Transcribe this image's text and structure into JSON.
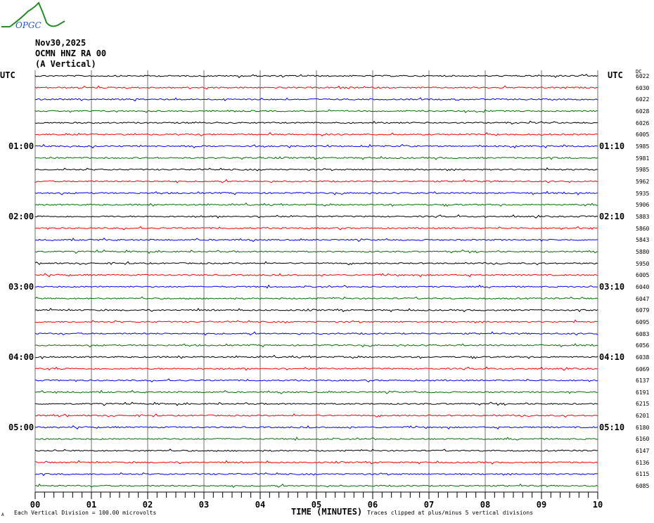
{
  "header": {
    "logo_text": "OPGC",
    "date": "Nov30,2025",
    "station": "OCMN HNZ RA 00",
    "component": "(A Vertical)",
    "utc_left": "UTC",
    "utc_right": "UTC",
    "dc_label": "DC"
  },
  "footer": {
    "division": "Each Vertical Division =  100.00 microvolts",
    "xlabel": "TIME (MINUTES)",
    "clipped": "Traces clipped at plus/minus 5 vertical divisions",
    "corner_mark": "A"
  },
  "chart_data": {
    "type": "line",
    "title": "Nov30,2025 OCMN HNZ RA 00 (A Vertical)",
    "xlabel": "TIME (MINUTES)",
    "xlim": [
      0,
      10
    ],
    "x_ticks": [
      "00",
      "01",
      "02",
      "03",
      "04",
      "05",
      "06",
      "07",
      "08",
      "09",
      "10"
    ],
    "left_hour_labels": [
      {
        "trace": 6,
        "text": "01:00"
      },
      {
        "trace": 12,
        "text": "02:00"
      },
      {
        "trace": 18,
        "text": "03:00"
      },
      {
        "trace": 24,
        "text": "04:00"
      },
      {
        "trace": 30,
        "text": "05:00"
      }
    ],
    "right_hour_labels": [
      {
        "trace": 6,
        "text": "01:10"
      },
      {
        "trace": 12,
        "text": "02:10"
      },
      {
        "trace": 18,
        "text": "03:10"
      },
      {
        "trace": 24,
        "text": "04:10"
      },
      {
        "trace": 30,
        "text": "05:10"
      }
    ],
    "trace_colors": [
      "#000000",
      "#ff0000",
      "#0000ff",
      "#007000"
    ],
    "dc_offsets": [
      6022,
      6030,
      6022,
      6028,
      6026,
      6005,
      5985,
      5981,
      5985,
      5962,
      5935,
      5906,
      5883,
      5860,
      5843,
      5880,
      5950,
      6005,
      6040,
      6047,
      6079,
      6095,
      6083,
      6056,
      6038,
      6069,
      6137,
      6191,
      6215,
      6201,
      6180,
      6160,
      6147,
      6136,
      6115,
      6085
    ],
    "grid": true
  }
}
